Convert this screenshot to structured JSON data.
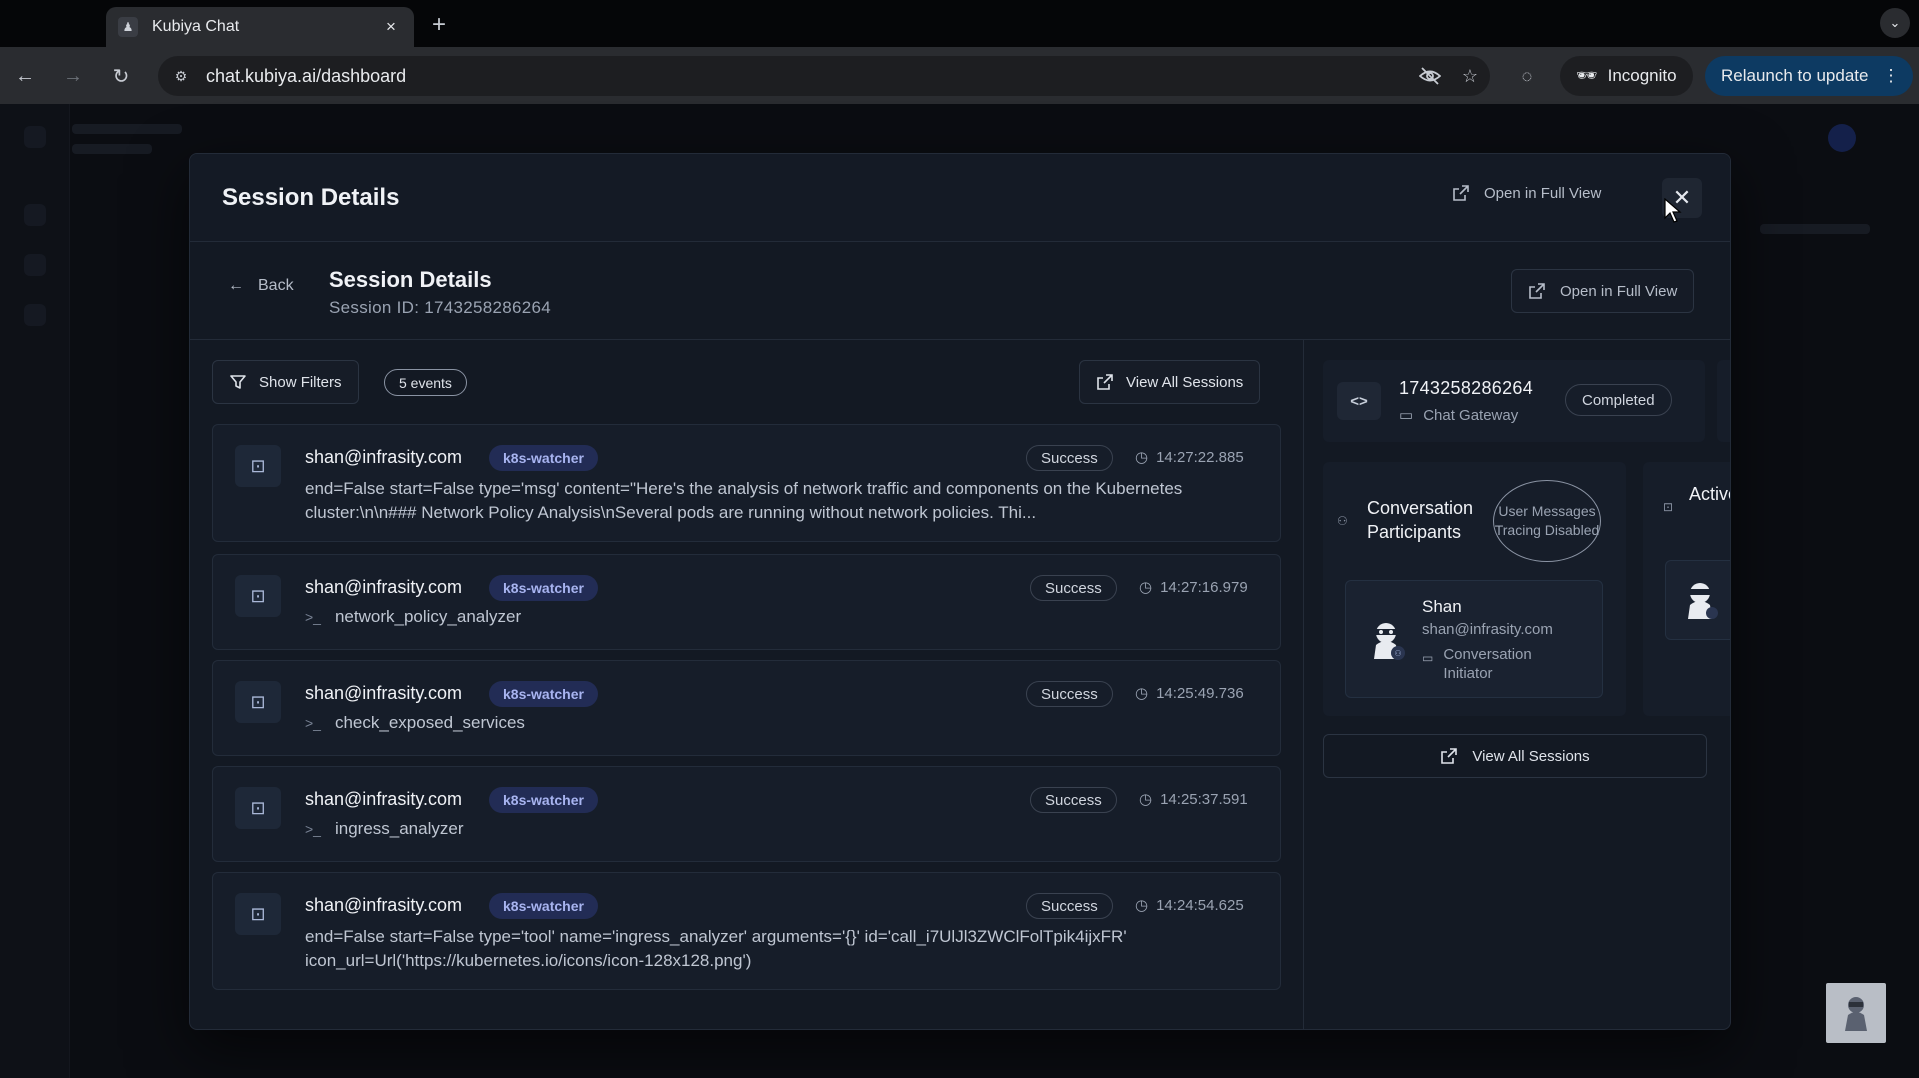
{
  "browser": {
    "tab_title": "Kubiya Chat",
    "tab_close": "×",
    "new_tab": "+",
    "url": "chat.kubiya.ai/dashboard",
    "incognito_label": "Incognito",
    "relaunch_label": "Relaunch to update"
  },
  "modal": {
    "title": "Session Details",
    "open_full_view": "Open in Full View",
    "close": "✕"
  },
  "subheader": {
    "back_label": "Back",
    "title": "Session Details",
    "session_id": "Session ID: 1743258286264",
    "open_full_view": "Open in Full View"
  },
  "events_toolbar": {
    "show_filters": "Show Filters",
    "events_count": "5 events",
    "view_all_sessions": "View All Sessions"
  },
  "events": [
    {
      "user": "shan@infrasity.com",
      "tag": "k8s-watcher",
      "status": "Success",
      "time": "14:27:22.885",
      "body": "end=False start=False type='msg' content=\"Here's the analysis of network traffic and components on the Kubernetes cluster:\\n\\n### Network Policy Analysis\\nSeveral pods are running without network policies. Thi..."
    },
    {
      "user": "shan@infrasity.com",
      "tag": "k8s-watcher",
      "status": "Success",
      "time": "14:27:16.979",
      "tool": "network_policy_analyzer"
    },
    {
      "user": "shan@infrasity.com",
      "tag": "k8s-watcher",
      "status": "Success",
      "time": "14:25:49.736",
      "tool": "check_exposed_services"
    },
    {
      "user": "shan@infrasity.com",
      "tag": "k8s-watcher",
      "status": "Success",
      "time": "14:25:37.591",
      "tool": "ingress_analyzer"
    },
    {
      "user": "shan@infrasity.com",
      "tag": "k8s-watcher",
      "status": "Success",
      "time": "14:24:54.625",
      "body": "end=False start=False type='tool' name='ingress_analyzer' arguments='{}' id='call_i7UlJl3ZWClFolTpik4ijxFR' icon_url=Url('https://kubernetes.io/icons/icon-128x128.png')"
    }
  ],
  "side": {
    "session_number": "1743258286264",
    "gateway": "Chat Gateway",
    "status": "Completed",
    "participants_title": "Conversation Participants",
    "tracing_badge": "User Messages Tracing Disabled",
    "participant": {
      "name": "Shan",
      "email": "shan@infrasity.com",
      "role": "Conversation Initiator"
    },
    "active_title": "Active Team",
    "view_all_sessions": "View All Sessions"
  },
  "colors": {
    "tag_bg": "#222c55",
    "tag_fg": "#a8b4f0",
    "relaunch_bg": "#0d3a62"
  }
}
